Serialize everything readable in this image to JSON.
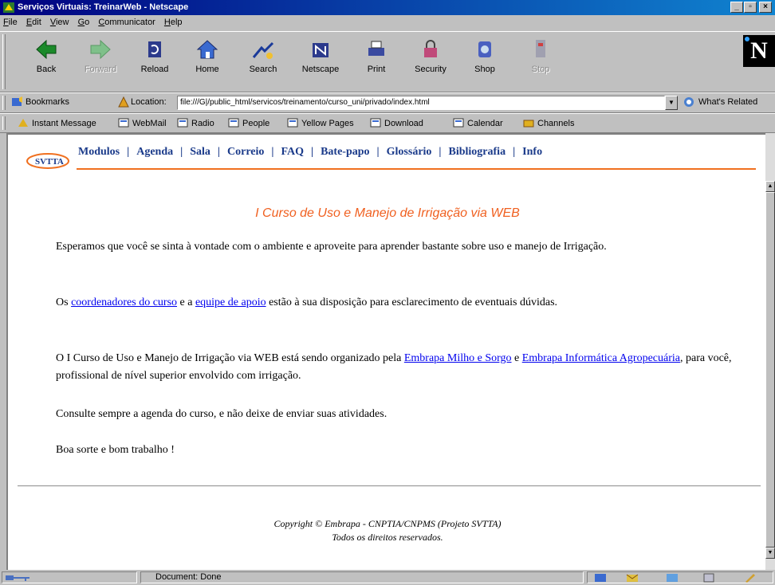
{
  "window": {
    "title": "Serviços Virtuais: TreinarWeb - Netscape"
  },
  "menu": [
    "File",
    "Edit",
    "View",
    "Go",
    "Communicator",
    "Help"
  ],
  "toolbar": {
    "buttons": [
      {
        "label": "Back",
        "icon": "back-arrow-icon"
      },
      {
        "label": "Forward",
        "icon": "forward-arrow-icon"
      },
      {
        "label": "Reload",
        "icon": "reload-icon"
      },
      {
        "label": "Home",
        "icon": "home-icon"
      },
      {
        "label": "Search",
        "icon": "search-icon"
      },
      {
        "label": "Netscape",
        "icon": "netscape-icon"
      },
      {
        "label": "Print",
        "icon": "print-icon"
      },
      {
        "label": "Security",
        "icon": "lock-icon"
      },
      {
        "label": "Shop",
        "icon": "shop-icon"
      },
      {
        "label": "Stop",
        "icon": "stop-icon"
      }
    ],
    "logo": "N"
  },
  "location": {
    "bookmarks_label": "Bookmarks",
    "location_label": "Location:",
    "url": "file:///G|/public_html/servicos/treinamento/curso_uni/privado/index.html",
    "related_label": "What's Related"
  },
  "personal_toolbar": [
    "Instant Message",
    "WebMail",
    "Radio",
    "People",
    "Yellow Pages",
    "Download",
    "Calendar",
    "Channels"
  ],
  "page": {
    "logo_text": "SVTTA",
    "nav": [
      "Modulos",
      "Agenda",
      "Sala",
      "Correio",
      "FAQ",
      "Bate-papo",
      "Glossário",
      "Bibliografia",
      "Info"
    ],
    "heading": "I Curso de Uso e Manejo de Irrigação via WEB",
    "p1": "Esperamos que você se sinta à vontade com o ambiente e aproveite para aprender bastante sobre uso e manejo de Irrigação.",
    "p2": {
      "t1": "Os ",
      "link1": "coordenadores do curso",
      "t2": " e a ",
      "link2": "equipe de apoio",
      "t3": " estão à sua disposição para esclarecimento de eventuais dúvidas."
    },
    "p3": {
      "t1": "O I Curso de Uso e Manejo de Irrigação via WEB está sendo organizado pela ",
      "link1": "Embrapa Milho e Sorgo",
      "t2": " e ",
      "link2": "Embrapa Informática Agropecuária",
      "t3": ", para você, profissional de nível superior envolvido com irrigação."
    },
    "p4": "Consulte sempre a agenda do curso, e não deixe de enviar suas atividades.",
    "p5": "Boa sorte e bom trabalho !",
    "footer_line1": "Copyright © Embrapa - CNPTIA/CNPMS (Projeto SVTTA)",
    "footer_line2": "Todos os direitos reservados."
  },
  "status": {
    "text": "Document: Done"
  }
}
